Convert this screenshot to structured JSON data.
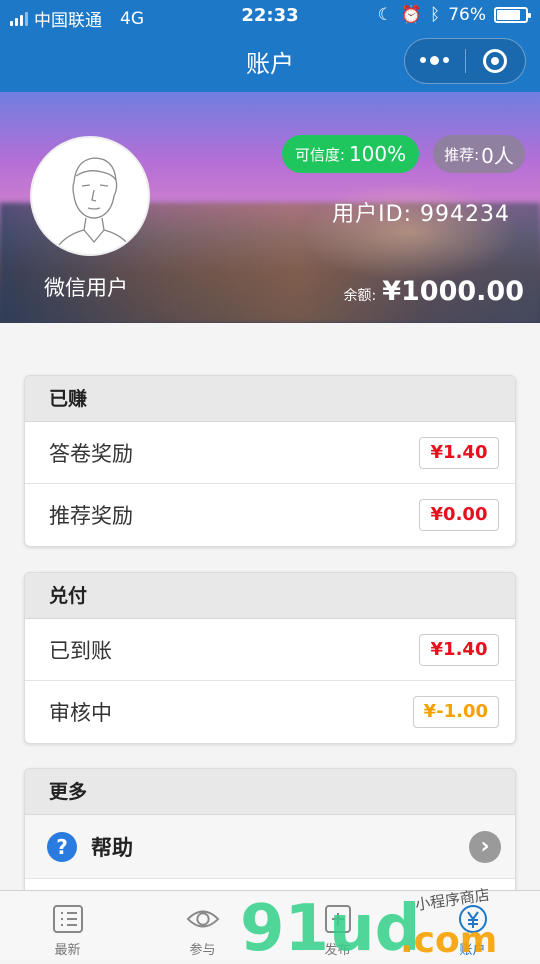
{
  "status": {
    "carrier": "中国联通",
    "network": "4G",
    "time": "22:33",
    "battery": "76%",
    "battery_level": 0.76
  },
  "navbar": {
    "title": "账户"
  },
  "profile": {
    "nickname": "微信用户",
    "credit_label": "可信度:",
    "credit_value": "100%",
    "referral_label": "推荐:",
    "referral_value": "0人",
    "user_id": "用户ID: 994234",
    "balance_label": "余额:",
    "balance_value": "¥1000.00"
  },
  "earned": {
    "title": "已赚",
    "rows": [
      {
        "label": "答卷奖励",
        "amount": "¥1.40"
      },
      {
        "label": "推荐奖励",
        "amount": "¥0.00"
      }
    ]
  },
  "payout": {
    "title": "兑付",
    "rows": [
      {
        "label": "已到账",
        "amount": "¥1.40"
      },
      {
        "label": "审核中",
        "amount": "¥-1.00"
      }
    ]
  },
  "more": {
    "title": "更多",
    "help_label": "帮助"
  },
  "tabs": [
    {
      "label": "最新",
      "icon": "list-icon"
    },
    {
      "label": "参与",
      "icon": "eye-icon"
    },
    {
      "label": "发布",
      "icon": "publish-icon"
    },
    {
      "label": "账户",
      "icon": "wallet-icon"
    }
  ],
  "watermark": {
    "brand": "91ud",
    "suffix": ".com",
    "tagline": "小程序商店"
  },
  "colors": {
    "primary": "#1e78c8",
    "credit_green": "#1fc65e",
    "amount_red": "#e8101e",
    "amount_orange": "#f5a100"
  }
}
